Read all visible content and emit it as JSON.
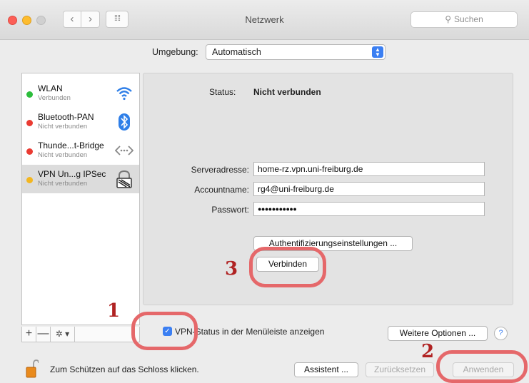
{
  "window": {
    "title": "Netzwerk",
    "search_placeholder": "Suchen"
  },
  "location": {
    "label": "Umgebung:",
    "value": "Automatisch"
  },
  "services": [
    {
      "name": "WLAN",
      "status": "Verbunden",
      "dot_color": "#2dbd3c",
      "icon": "wifi-icon"
    },
    {
      "name": "Bluetooth-PAN",
      "status": "Nicht verbunden",
      "dot_color": "#ea3b32",
      "icon": "bluetooth-icon"
    },
    {
      "name": "Thunde...t-Bridge",
      "status": "Nicht verbunden",
      "dot_color": "#ea3b32",
      "icon": "thunderbolt-bridge-icon"
    },
    {
      "name": "VPN Un...g IPSec",
      "status": "Nicht verbunden",
      "dot_color": "#f3b61f",
      "icon": "vpn-lock-icon"
    }
  ],
  "sidebar_toolbar": {
    "add": "+",
    "remove": "—",
    "gear": "✲ ▾"
  },
  "detail": {
    "status_label": "Status:",
    "status_value": "Nicht verbunden",
    "server_label": "Serveradresse:",
    "server_value": "home-rz.vpn.uni-freiburg.de",
    "account_label": "Accountname:",
    "account_value": "rg4@uni-freiburg.de",
    "password_label": "Passwort:",
    "password_value": "●●●●●●●●●●●",
    "auth_button": "Authentifizierungseinstellungen ...",
    "connect_button": "Verbinden"
  },
  "menubar_checkbox": {
    "checked": true,
    "label": "VPN-Status in der Menüleiste anzeigen"
  },
  "more_options_button": "Weitere Optionen ...",
  "help": "?",
  "footer": {
    "lock_text": "Zum Schützen auf das Schloss klicken.",
    "assistant_button": "Assistent ...",
    "revert_button": "Zurücksetzen",
    "apply_button": "Anwenden"
  },
  "annotations": [
    {
      "number": "1"
    },
    {
      "number": "2"
    },
    {
      "number": "3"
    }
  ],
  "colors": {
    "accent": "#3b7ff2",
    "annotation": "#e5686a",
    "annotation_text": "#b02222"
  }
}
